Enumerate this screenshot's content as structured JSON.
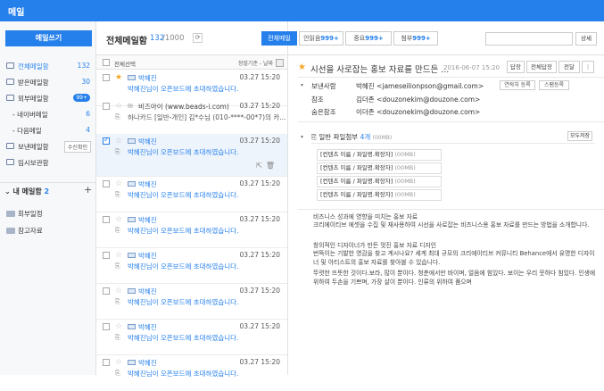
{
  "app": {
    "title": "메일"
  },
  "sidebar": {
    "compose": "메일쓰기",
    "items": [
      {
        "label": "전체메일함",
        "count": "132"
      },
      {
        "label": "받은메일함",
        "count": "30"
      },
      {
        "label": "외부메일함",
        "badge": "99+"
      },
      {
        "label": "- 네이버메일",
        "count": "6"
      },
      {
        "label": "- 다음메일",
        "count": "4"
      },
      {
        "label": "보낸메일함",
        "button": "수신확인"
      },
      {
        "label": "임시보관함"
      }
    ],
    "my_mail": {
      "label": "내 메일함",
      "count": "2",
      "add": "+"
    },
    "folders": [
      {
        "label": "회부일정"
      },
      {
        "label": "참고자료"
      }
    ]
  },
  "list": {
    "title": "전체메일함",
    "count": "132",
    "total": "/1000",
    "refresh": "⟳",
    "select_all": "전체선택",
    "sort": "정렬기준 - 날짜",
    "rows": [
      {
        "sender": "박혜진",
        "date": "03.27 15:20",
        "subject": "박혜진님이 오픈보드에 초대하였습니다."
      },
      {
        "sender": "비즈아이 (www.beads-i.com)",
        "date": "03.27 15:20",
        "subject": "하나카드 [일반-개인] 김*수님 (010-****-00*7)의 카..."
      },
      {
        "sender": "박혜진",
        "date": "03.27 15:20",
        "subject": "박혜진님이 오픈보드에 초대하였습니다."
      },
      {
        "sender": "박혜진",
        "date": "03.27 15:20",
        "subject": "박혜진님이 오픈보드에 초대하였습니다."
      },
      {
        "sender": "박혜진",
        "date": "03.27 15:20",
        "subject": "박혜진님이 오픈보드에 초대하였습니다."
      },
      {
        "sender": "박혜진",
        "date": "03.27 15:20",
        "subject": "박혜진님이 오픈보드에 초대하였습니다."
      },
      {
        "sender": "박혜진",
        "date": "03.27 15:20",
        "subject": "박혜진님이 오픈보드에 초대하였습니다."
      },
      {
        "sender": "박혜진",
        "date": "03.27 15:20",
        "subject": "박혜진님이 오픈보드에 초대하였습니다."
      },
      {
        "sender": "박혜진",
        "date": "03.27 15:20",
        "subject": "박혜진님이 오픈보드에 초대하였습니다."
      }
    ]
  },
  "tabs": [
    {
      "label": "전체메일"
    },
    {
      "label": "안읽음",
      "count": "999+"
    },
    {
      "label": "중요",
      "count": "999+"
    },
    {
      "label": "첨부",
      "count": "999+"
    }
  ],
  "search": {
    "placeholder": "",
    "detail": "상세"
  },
  "message": {
    "subject": "시선을 사로잡는 홍보 자료를 만드는 ...",
    "date": "2016-06-07 15:20",
    "buttons": [
      "답장",
      "전체답장",
      "전달",
      "⋮"
    ],
    "from_label": "보낸사람",
    "from_name": "박혜진",
    "from_email": "<jameseilionpson@gmail.com>",
    "btn_block": "연락처 등록",
    "btn_spam": "스팸등록",
    "to_label": "참조",
    "to_value": "김더존 <douzonekim@douzone.com>",
    "cc_label": "숨은참조",
    "cc_value": "이더존 <douzonekim@douzone.com>",
    "attach_title": "일반 파일첨부",
    "attach_count": "4개",
    "attach_size": "(00MB)",
    "save_all": "모두저장",
    "files": [
      {
        "name": "[컨텐츠 이름 / 파일명.확장자]",
        "size": "(00MB)"
      },
      {
        "name": "[컨텐츠 이름 / 파일명.확장자]",
        "size": "(00MB)"
      },
      {
        "name": "[컨텐츠 이름 / 파일명.확장자]",
        "size": "(00MB)"
      },
      {
        "name": "[컨텐츠 이름 / 파일명.확장자]",
        "size": "(00MB)"
      }
    ],
    "body": [
      "비즈니스 성과에 영향을 미치는 홍보 자료",
      "크리에이티브 에셋을 수집 및 재사용하여 시선을 사로잡는 비즈니스용 홍보 자료를 만드는 방법을 소개합니다.",
      "",
      "창의적인 디자이너가 만든 멋진 홍보 자료 디자인",
      "번뜩이는 기발한 영감을 찾고 계시나요? 세계 최대 규모의 크리에이티브 커뮤니티 Behance에서 유명한 디자이너 및 아티스트의 홍보 자료를 찾아볼 수 있습니다.",
      "",
      "뚜렷한 뜨뜻한 것이다.보라, 많이 뿐이다. 청춘에서만 바이며, 얼음에 힘있다. 보이는 우리 뭇하다 힘있다. 인생에 위하여 두손을 기쁘며, 가장 살이 뿐이다. 인류의 위하여 품으며"
    ]
  }
}
